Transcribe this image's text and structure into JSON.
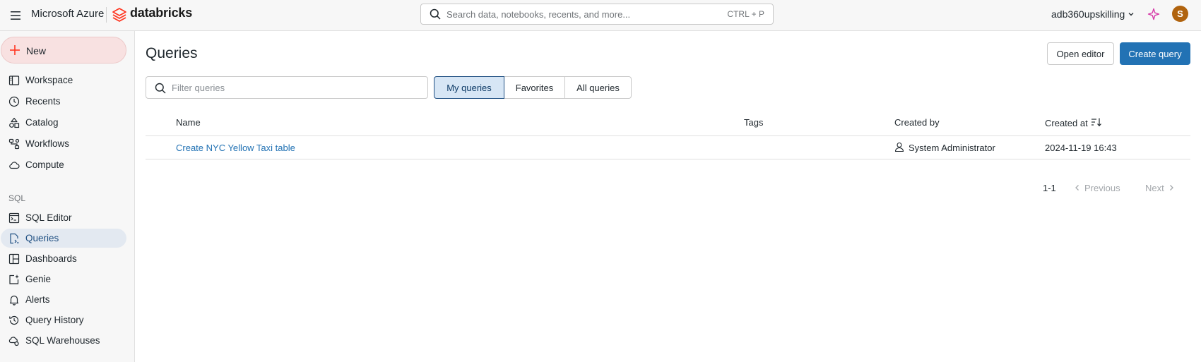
{
  "header": {
    "menu_icon": "hamburger-menu-icon",
    "brand_azure": "Microsoft Azure",
    "brand_databricks": "databricks",
    "search_placeholder": "Search data, notebooks, recents, and more...",
    "search_shortcut": "CTRL + P",
    "workspace": "adb360upskilling",
    "avatar_initial": "S",
    "brand_color": "#ff3621",
    "avatar_color": "#b0630e"
  },
  "sidebar": {
    "new_label": "New",
    "items": [
      {
        "label": "Workspace",
        "icon": "workspace-icon"
      },
      {
        "label": "Recents",
        "icon": "clock-icon"
      },
      {
        "label": "Catalog",
        "icon": "catalog-icon"
      },
      {
        "label": "Workflows",
        "icon": "workflows-icon"
      },
      {
        "label": "Compute",
        "icon": "cloud-icon"
      }
    ],
    "sql_section_label": "SQL",
    "sql_items": [
      {
        "label": "SQL Editor",
        "icon": "sql-editor-icon"
      },
      {
        "label": "Queries",
        "icon": "queries-icon",
        "active": true
      },
      {
        "label": "Dashboards",
        "icon": "dashboards-icon"
      },
      {
        "label": "Genie",
        "icon": "genie-icon"
      },
      {
        "label": "Alerts",
        "icon": "bell-icon"
      },
      {
        "label": "Query History",
        "icon": "history-icon"
      },
      {
        "label": "SQL Warehouses",
        "icon": "warehouse-icon"
      }
    ]
  },
  "main": {
    "title": "Queries",
    "open_editor_label": "Open editor",
    "create_query_label": "Create query",
    "filter_placeholder": "Filter queries",
    "segments": [
      "My queries",
      "Favorites",
      "All queries"
    ],
    "selected_segment": "My queries",
    "columns": [
      "Name",
      "Tags",
      "Created by",
      "Created at"
    ],
    "rows": [
      {
        "name": "Create NYC Yellow Taxi table",
        "tags": "",
        "created_by": "System Administrator",
        "created_at": "2024-11-19 16:43"
      }
    ],
    "pagination": {
      "range": "1-1",
      "previous_label": "Previous",
      "next_label": "Next"
    },
    "accent_color": "#2272b4"
  }
}
